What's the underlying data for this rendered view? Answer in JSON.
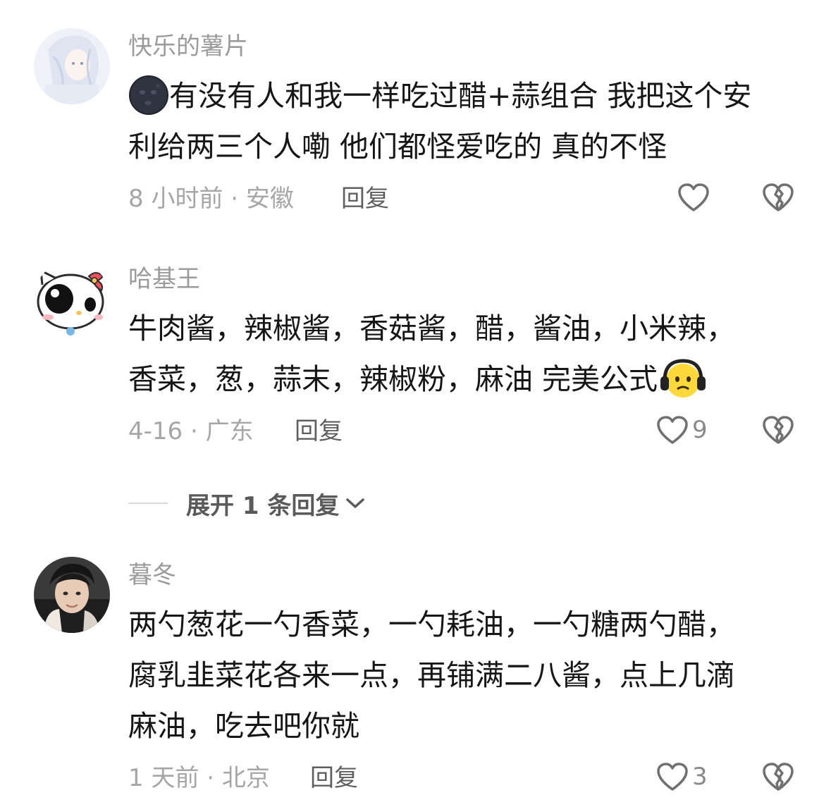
{
  "comments": [
    {
      "username": "快乐的薯片",
      "lines": [
        "有没有人和我一样吃过醋+蒜组合 我把这个安",
        "利给两三个人嘞 他们都怪爱吃的 真的不怪"
      ],
      "leading_emoji": "new-moon-face-emoji",
      "time_location": "8 小时前 · 安徽",
      "reply_label": "回复",
      "likes": ""
    },
    {
      "username": "哈基王",
      "lines": [
        "牛肉酱，辣椒酱，香菇酱，醋，酱油，小米辣，",
        "香菜，葱，蒜末，辣椒粉，麻油 完美公式"
      ],
      "trailing_emoji": "headphones-face-emoji",
      "time_location": "4-16 · 广东",
      "reply_label": "回复",
      "likes": "9",
      "expand_label": "展开 1 条回复"
    },
    {
      "username": "暮冬",
      "lines": [
        "两勺葱花一勺香菜，一勺耗油，一勺糖两勺醋，",
        "腐乳韭菜花各来一点，再铺满二八酱，点上几滴",
        "麻油，吃去吧你就"
      ],
      "time_location": "1 天前 · 北京",
      "reply_label": "回复",
      "likes": "3"
    }
  ],
  "icons": {
    "like": "heart-outline-icon",
    "dislike": "broken-heart-outline-icon",
    "expand": "chevron-down-icon"
  },
  "colors": {
    "username": "#9b9b9b",
    "body": "#161616",
    "meta": "#a6a6a6",
    "reply": "#5f5f5f",
    "icon": "#707070"
  }
}
